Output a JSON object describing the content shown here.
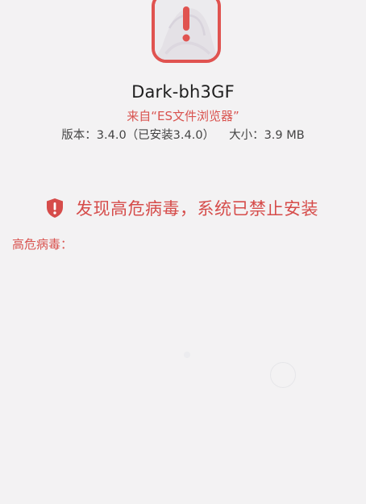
{
  "app": {
    "name": "Dark-bh3GF",
    "source": "来自“ES文件浏览器”",
    "version": "版本：3.4.0（已安装3.4.0）",
    "size": "大小：3.9 MB"
  },
  "warning": {
    "text": "发现高危病毒，系统已禁止安装",
    "icon": "shield-alert-icon"
  },
  "virus_section": {
    "label": "高危病毒："
  },
  "colors": {
    "accent_red": "#d9534f",
    "background": "#f3f2f3"
  }
}
